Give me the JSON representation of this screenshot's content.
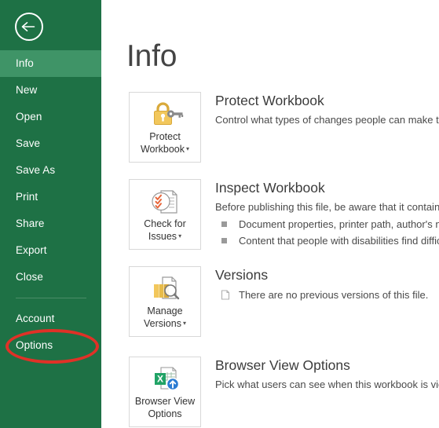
{
  "sidebar": {
    "back_button": {
      "icon": "back-arrow-icon"
    },
    "items": [
      {
        "label": "Info",
        "active": true,
        "type": "item"
      },
      {
        "label": "New",
        "active": false,
        "type": "item"
      },
      {
        "label": "Open",
        "active": false,
        "type": "item"
      },
      {
        "label": "Save",
        "active": false,
        "type": "item"
      },
      {
        "label": "Save As",
        "active": false,
        "type": "item"
      },
      {
        "label": "Print",
        "active": false,
        "type": "item"
      },
      {
        "label": "Share",
        "active": false,
        "type": "item"
      },
      {
        "label": "Export",
        "active": false,
        "type": "item"
      },
      {
        "label": "Close",
        "active": false,
        "type": "item"
      },
      {
        "label": "",
        "active": false,
        "type": "separator"
      },
      {
        "label": "Account",
        "active": false,
        "type": "item"
      },
      {
        "label": "Options",
        "active": false,
        "type": "item"
      }
    ],
    "background_color": "#1e7145",
    "active_color": "#3f9467"
  },
  "annotation": {
    "target_label": "Options",
    "shape": "ellipse",
    "color": "#e03127"
  },
  "main": {
    "title": "Info",
    "sections": [
      {
        "tile_label_line1": "Protect",
        "tile_label_line2": "Workbook",
        "tile_has_caret": true,
        "tile_icon": "padlock-key-icon",
        "heading": "Protect Workbook",
        "description": "Control what types of changes people can make to th",
        "bullets": [],
        "version_note": ""
      },
      {
        "tile_label_line1": "Check for",
        "tile_label_line2": "Issues",
        "tile_has_caret": true,
        "tile_icon": "document-check-magnifier-icon",
        "heading": "Inspect Workbook",
        "description": "Before publishing this file, be aware that it contains:",
        "bullets": [
          "Document properties, printer path, author's name",
          "Content that people with disabilities find difficul"
        ],
        "version_note": ""
      },
      {
        "tile_label_line1": "Manage",
        "tile_label_line2": "Versions",
        "tile_has_caret": true,
        "tile_icon": "document-stack-magnifier-icon",
        "heading": "Versions",
        "description": "",
        "bullets": [],
        "version_note": "There are no previous versions of this file."
      },
      {
        "tile_label_line1": "Browser View",
        "tile_label_line2": "Options",
        "tile_has_caret": false,
        "tile_icon": "excel-upload-icon",
        "heading": "Browser View Options",
        "description": "Pick what users can see when this workbook is viewed",
        "bullets": [],
        "version_note": ""
      }
    ]
  }
}
